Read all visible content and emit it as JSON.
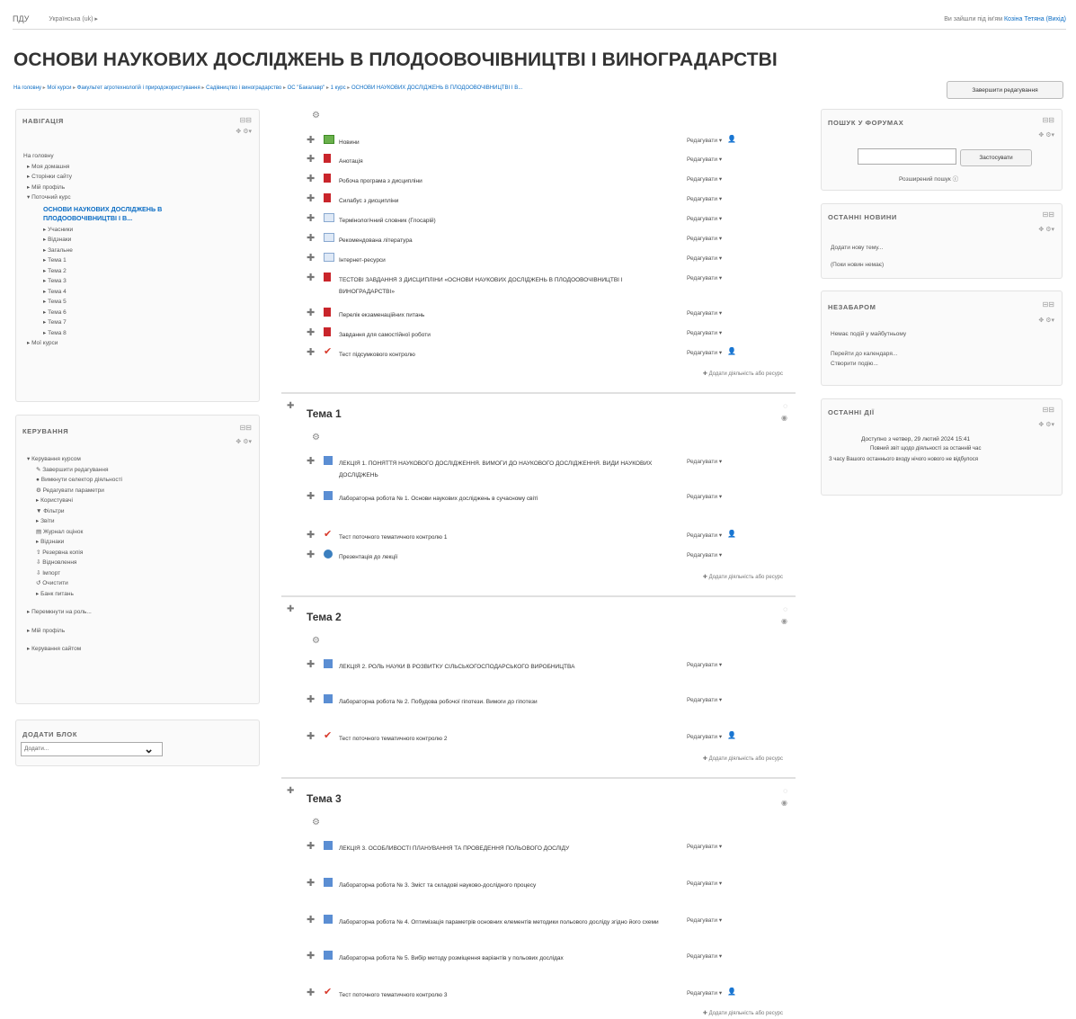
{
  "topbar": {
    "brand": "ПДУ",
    "language": "Українська (uk) ▸",
    "login_prefix": "Ви зайшли під ім'ям",
    "user_name": "Козіна Тетяна",
    "logout": "(Вихід)"
  },
  "page": {
    "title": "ОСНОВИ НАУКОВИХ ДОСЛІДЖЕНЬ В ПЛОДООВОЧІВНИЦТВІ І ВИНОГРАДАРСТВІ",
    "edit_button": "Завершити редагування"
  },
  "breadcrumb": [
    "На головну",
    "Мої курси",
    "Факультет агротехнологій і природокористування",
    "Садівництво і виноградарство",
    "ОС \"Бакалавр\"",
    "1 курс",
    "ОСНОВИ НАУКОВИХ ДОСЛІДЖЕНЬ В ПЛОДООВОЧІВНИЦТВІ І В..."
  ],
  "navigation": {
    "title": "НАВІГАЦІЯ",
    "items": [
      "На головну",
      "▸ Моя домашня",
      "▸ Сторінки сайту",
      "▸ Мій профіль",
      "▾ Поточний курс",
      "ОСНОВИ НАУКОВИХ ДОСЛІДЖЕНЬ В ПЛОДООВОЧІВНИЦТВІ І В...",
      "▸ Учасники",
      "▸ Відзнаки",
      "▸ Загальне",
      "▸ Тема 1",
      "▸ Тема 2",
      "▸ Тема 3",
      "▸ Тема 4",
      "▸ Тема 5",
      "▸ Тема 6",
      "▸ Тема 7",
      "▸ Тема 8",
      "▸ Мої курси"
    ]
  },
  "admin": {
    "title": "КЕРУВАННЯ",
    "items": [
      "▾ Керування курсом",
      "✎ Завершити редагування",
      "● Вимкнути селектор діяльності",
      "⚙ Редагувати параметри",
      "▸ Користувачі",
      "▼ Фільтри",
      "▸ Звіти",
      "▤ Журнал оцінок",
      "▸ Відзнаки",
      "⇧ Резервна копія",
      "⇩ Відновлення",
      "⇩ Імпорт",
      "↺ Очистити",
      "▸ Банк питань",
      "▸ Перемкнути на роль...",
      "▸ Мій профіль",
      "▸ Керування сайтом"
    ]
  },
  "add_block": {
    "title": "ДОДАТИ БЛОК",
    "select_value": "Додати..."
  },
  "forum_search": {
    "title": "ПОШУК У ФОРУМАХ",
    "button": "Застосувати",
    "advanced": "Розширений пошук"
  },
  "latest_news": {
    "title": "ОСТАННІ НОВИНИ",
    "add_topic": "Додати нову тему...",
    "empty": "(Поки новин немає)"
  },
  "upcoming": {
    "title": "НЕЗАБАРОМ",
    "empty": "Немає подій у майбутньому",
    "calendar_link": "Перейти до календаря...",
    "new_event": "Створити подію..."
  },
  "recent": {
    "title": "ОСТАННІ ДІЇ",
    "since": "Доступно з четвер, 29 лютий 2024 15:41",
    "report": "Повний звіт щодо діяльності за останній час",
    "nothing": "З часу Вашого останнього входу нічого нового не відбулося"
  },
  "labels": {
    "edit": "Редагувати ▾",
    "add_activity": "✚ Додати діяльність або ресурс"
  },
  "general_activities": [
    {
      "icon": "forum-icon",
      "name": "Новини"
    },
    {
      "icon": "pdf-icon",
      "name": "Анотація"
    },
    {
      "icon": "pdf-icon",
      "name": "Робоча програма з дисципліни"
    },
    {
      "icon": "pdf-icon",
      "name": "Силабус з дисципліни"
    },
    {
      "icon": "glossary-icon",
      "name": "Термінологічний словник (Глосарій)"
    },
    {
      "icon": "page-icon",
      "name": "Рекомендована література"
    },
    {
      "icon": "page-icon",
      "name": "Інтернет-ресурси"
    },
    {
      "icon": "pdf-icon",
      "name": "ТЕСТОВІ ЗАВДАННЯ З ДИСЦИПЛІНИ «ОСНОВИ НАУКОВИХ ДОСЛІДЖЕНЬ В ПЛОДООВОЧІВНИЦТВІ І ВИНОГРАДАРСТВІ»"
    },
    {
      "icon": "pdf-icon",
      "name": "Перелік екзаменаційних питань"
    },
    {
      "icon": "pdf-icon",
      "name": "Завдання для самостійної роботи"
    },
    {
      "icon": "quiz-icon",
      "name": "Тест підсумкового контролю"
    }
  ],
  "sections": [
    {
      "title": "Тема 1",
      "activities": [
        {
          "icon": "lesson-icon",
          "name": "ЛЕКЦІЯ 1. ПОНЯТТЯ НАУКОВОГО ДОСЛІДЖЕННЯ. ВИМОГИ ДО НАУКОВОГО ДОСЛІДЖЕННЯ. ВИДИ НАУКОВИХ ДОСЛІДЖЕНЬ"
        },
        {
          "icon": "lesson-icon",
          "name": "Лабораторна робота № 1. Основи наукових досліджень в сучасному світі"
        },
        {
          "icon": "quiz-icon",
          "name": "Тест поточного тематичного контролю 1"
        },
        {
          "icon": "url-icon",
          "name": "Презентація до лекції"
        }
      ]
    },
    {
      "title": "Тема 2",
      "activities": [
        {
          "icon": "lesson-icon",
          "name": "ЛЕКЦІЯ 2. РОЛЬ НАУКИ В РОЗВИТКУ СІЛЬСЬКОГОСПОДАРСЬКОГО ВИРОБНИЦТВА"
        },
        {
          "icon": "lesson-icon",
          "name": "Лабораторна робота № 2. Побудова робочої гіпотези. Вимоги до гіпотези"
        },
        {
          "icon": "quiz-icon",
          "name": "Тест поточного тематичного контролю 2"
        }
      ]
    },
    {
      "title": "Тема 3",
      "activities": [
        {
          "icon": "lesson-icon",
          "name": "ЛЕКЦІЯ 3. ОСОБЛИВОСТІ ПЛАНУВАННЯ ТА ПРОВЕДЕННЯ ПОЛЬОВОГО ДОСЛІДУ"
        },
        {
          "icon": "lesson-icon",
          "name": "Лабораторна робота № 3. Зміст та складові науково-дослідного процесу"
        },
        {
          "icon": "lesson-icon",
          "name": "Лабораторна робота № 4. Оптимізація параметрів основних елементів методики польового досліду згідно його схеми"
        },
        {
          "icon": "lesson-icon",
          "name": "Лабораторна робота № 5. Вибір методу розміщення варіантів у польових дослідах"
        },
        {
          "icon": "quiz-icon",
          "name": "Тест поточного тематичного контролю 3"
        }
      ]
    }
  ]
}
